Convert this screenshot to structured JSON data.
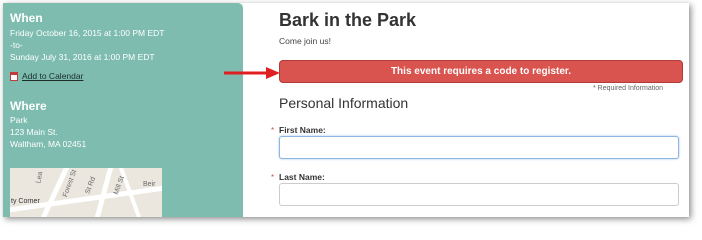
{
  "sidebar": {
    "when_title": "When",
    "start_datetime": "Friday October 16, 2015 at 1:00 PM EDT",
    "separator": "-to-",
    "end_datetime": "Sunday July 31, 2016 at 1:00 PM EDT",
    "add_to_calendar": "Add to Calendar",
    "where_title": "Where",
    "venue": "Park",
    "street": "123 Main St.",
    "city": "Waltham, MA 02451",
    "map_labels": [
      "Lea",
      "Forest St",
      "St Rd",
      "Mill St",
      "Beir",
      "ty Corner"
    ]
  },
  "event": {
    "title": "Bark in the Park",
    "subtitle": "Come join us!"
  },
  "alert": {
    "message": "This event requires a code to register.",
    "color": "#d9534f"
  },
  "form": {
    "required_note": "* Required Information",
    "section_title": "Personal Information",
    "fields": [
      {
        "label": "First Name:",
        "value": ""
      },
      {
        "label": "Last Name:",
        "value": ""
      }
    ]
  },
  "colors": {
    "sidebar_bg": "#7dbcaf",
    "arrow": "#e02020"
  }
}
